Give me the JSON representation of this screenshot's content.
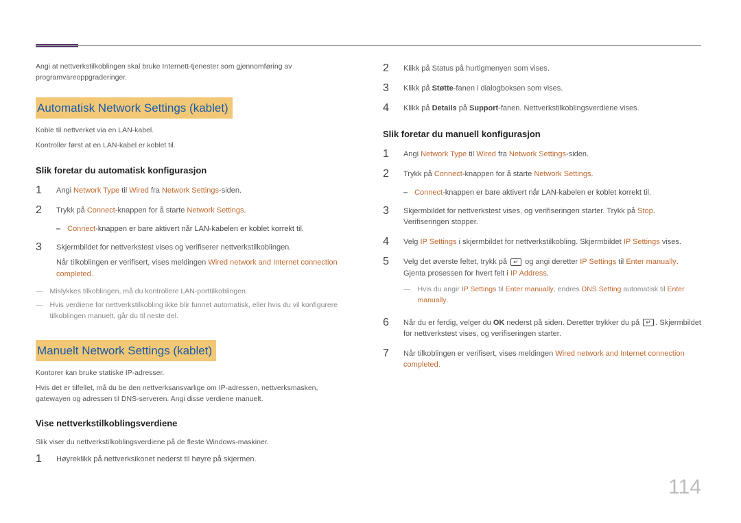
{
  "page_number": "114",
  "left": {
    "intro": "Angi at nettverkstilkoblingen skal bruke Internett-tjenester som gjennomføring av programvareoppgraderinger.",
    "section1": {
      "title": "Automatisk Network Settings  (kablet)",
      "p1": "Koble til nettverket via en LAN-kabel.",
      "p2": "Kontroller først at en LAN-kabel er koblet til.",
      "sub": "Slik foretar du automatisk konfigurasjon",
      "step1_a": "Angi ",
      "step1_b": "Network Type",
      "step1_c": " til ",
      "step1_d": "Wired",
      "step1_e": " fra ",
      "step1_f": "Network Settings",
      "step1_g": "-siden.",
      "step2_a": "Trykk på ",
      "step2_b": "Connect",
      "step2_c": "-knappen for å starte ",
      "step2_d": "Network Settings",
      "step2_e": ".",
      "bullet_a": "Connect",
      "bullet_b": "-knappen er bare aktivert når LAN-kabelen er koblet korrekt til.",
      "step3": "Skjermbildet for nettverkstest vises og verifiserer nettverkstilkoblingen.",
      "step3_b1": "Når tilkoblingen er verifisert, vises meldingen ",
      "step3_b2": "Wired network and Internet connection completed.",
      "note1": "Mislykkes tilkoblingen, må du kontrollere LAN-porttilkoblingen.",
      "note2": "Hvis verdiene for nettverkstilkobling ikke blir funnet automatisk, eller hvis du vil konfigurere tilkoblingen manuelt, går du til neste del."
    },
    "section2": {
      "title": "Manuelt Network Settings (kablet)",
      "p1": "Kontorer kan bruke statiske IP-adresser.",
      "p2": "Hvis det er tilfellet, må du be den nettverksansvarlige om IP-adressen, nettverksmasken, gatewayen og adressen til DNS-serveren. Angi disse verdiene manuelt.",
      "sub": "Vise nettverkstilkoblingsverdiene",
      "p3": "Slik viser du nettverkstilkoblingsverdiene på de fleste Windows-maskiner.",
      "step1": "Høyreklikk på nettverksikonet nederst til høyre på skjermen."
    }
  },
  "right": {
    "step2": "Klikk på Status på hurtigmenyen som vises.",
    "step3_a": "Klikk på ",
    "step3_b": "Støtte",
    "step3_c": "-fanen i dialogboksen som vises.",
    "step4_a": "Klikk på ",
    "step4_b": "Details",
    "step4_c": " på ",
    "step4_d": "Support",
    "step4_e": "-fanen. Nettverkstilkoblingsverdiene vises.",
    "sub": "Slik foretar du manuell konfigurasjon",
    "m1_a": "Angi ",
    "m1_b": "Network Type",
    "m1_c": " til ",
    "m1_d": "Wired",
    "m1_e": " fra ",
    "m1_f": "Network Settings",
    "m1_g": "-siden.",
    "m2_a": "Trykk på ",
    "m2_b": "Connect",
    "m2_c": "-knappen for å starte ",
    "m2_d": "Network Settings",
    "m2_e": ".",
    "mbul_a": "Connect",
    "mbul_b": "-knappen er bare aktivert når LAN-kabelen er koblet korrekt til.",
    "m3_a": "Skjermbildet for nettverkstest vises, og verifiseringen starter. Trykk på ",
    "m3_b": "Stop",
    "m3_c": ". Verifiseringen stopper.",
    "m4_a": "Velg ",
    "m4_b": "IP Settings",
    "m4_c": " i skjermbildet for nettverkstilkobling. Skjermbildet ",
    "m4_d": "IP Settings",
    "m4_e": " vises.",
    "m5_a": "Velg det øverste feltet, trykk på ",
    "m5_b": " og angi deretter ",
    "m5_c": "IP Settings",
    "m5_d": " til ",
    "m5_e": "Enter manually",
    "m5_f": ". Gjenta prosessen for hvert felt i ",
    "m5_g": "IP Address",
    "m5_h": ".",
    "mnote_a": "Hvis du angir ",
    "mnote_b": "IP Settings",
    "mnote_c": " til ",
    "mnote_d": "Enter manually",
    "mnote_e": ", endres ",
    "mnote_f": "DNS Setting",
    "mnote_g": " automatisk til ",
    "mnote_h": "Enter manually",
    "mnote_i": ".",
    "m6_a": "Når du er ferdig, velger du ",
    "m6_b": "OK",
    "m6_c": " nederst på siden. Deretter trykker du på ",
    "m6_d": ". Skjermbildet for nettverkstest vises, og verifiseringen starter.",
    "m7_a": "Når tilkoblingen er verifisert, vises meldingen ",
    "m7_b": "Wired network and Internet connection completed."
  }
}
